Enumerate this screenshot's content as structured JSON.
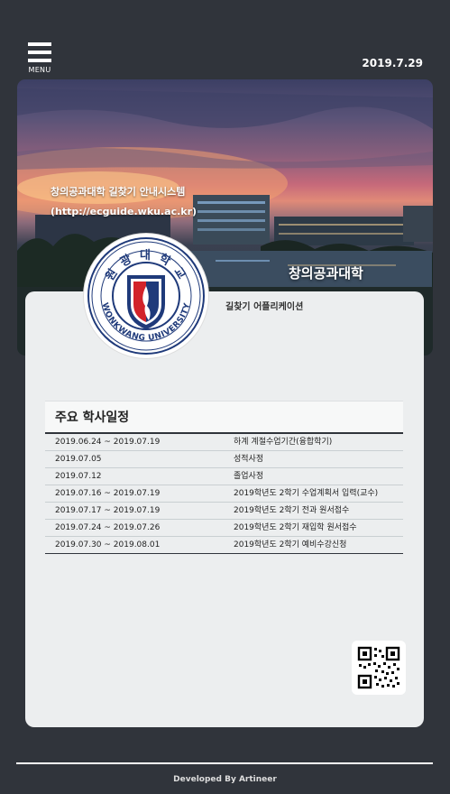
{
  "header": {
    "menu_label": "MENU",
    "date": "2019.7.29"
  },
  "hero": {
    "system_title": "창의공과대학 길찾기 안내시스템",
    "url": "(http://ecguide.wku.ac.kr)",
    "campus_name": "창의공과대학"
  },
  "logo": {
    "korean_name": "원 광 대 학 교",
    "english_name": "WONKWANG UNIVERSITY"
  },
  "app_label": "길찾기 어플리케이션",
  "schedule": {
    "title": "주요 학사일정",
    "rows": [
      {
        "date": "2019.06.24 ~ 2019.07.19",
        "event": "하계 계절수업기간(융합학기)"
      },
      {
        "date": "2019.07.05",
        "event": "성적사정"
      },
      {
        "date": "2019.07.12",
        "event": "졸업사정"
      },
      {
        "date": "2019.07.16 ~ 2019.07.19",
        "event": "2019학년도 2학기 수업계획서 입력(교수)"
      },
      {
        "date": "2019.07.17 ~ 2019.07.19",
        "event": "2019학년도 2학기 전과 원서접수"
      },
      {
        "date": "2019.07.24 ~ 2019.07.26",
        "event": "2019학년도 2학기 재입학 원서접수"
      },
      {
        "date": "2019.07.30 ~ 2019.08.01",
        "event": "2019학년도 2학기 예비수강신청"
      }
    ]
  },
  "footer": {
    "credit": "Developed By Artineer"
  },
  "colors": {
    "background": "#30343b",
    "panel": "#eceeef",
    "logo_blue": "#1f3a7a",
    "logo_red": "#d2232a"
  }
}
